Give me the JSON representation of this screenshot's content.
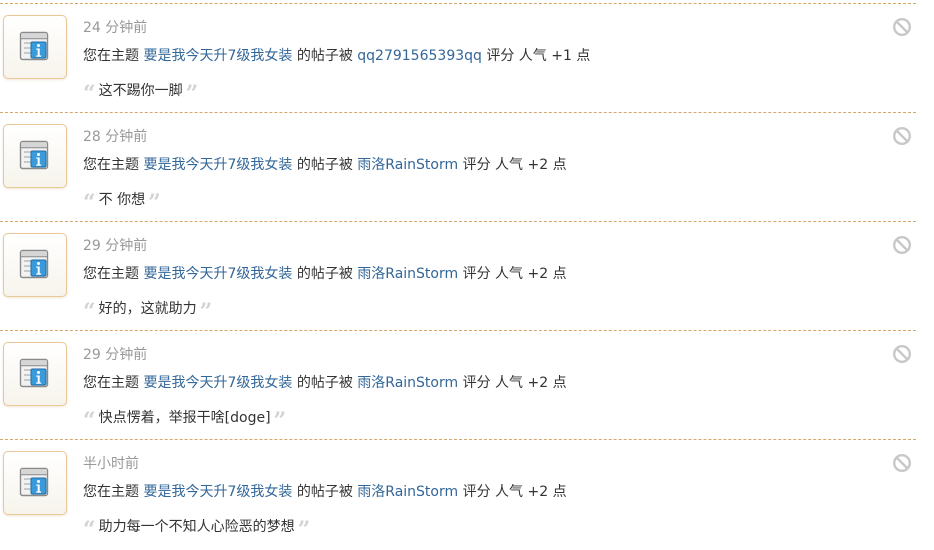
{
  "icons": {
    "avatar": "system-notice-info-icon",
    "ignore": "ignore-notice-icon"
  },
  "colors": {
    "link": "#336699",
    "divider": "#d8a66a",
    "muted": "#999999"
  },
  "notices": [
    {
      "time": "24 分钟前",
      "prefix": "您在主题",
      "thread_title": "要是我今天升7级我女装",
      "middle": "的帖子被",
      "rater": "qq2791565393qq",
      "suffix": "评分 人气 +1 点",
      "reason": "这不踢你一脚"
    },
    {
      "time": "28 分钟前",
      "prefix": "您在主题",
      "thread_title": "要是我今天升7级我女装",
      "middle": "的帖子被",
      "rater": "雨洛RainStorm",
      "suffix": "评分 人气 +2 点",
      "reason": "不 你想"
    },
    {
      "time": "29 分钟前",
      "prefix": "您在主题",
      "thread_title": "要是我今天升7级我女装",
      "middle": "的帖子被",
      "rater": "雨洛RainStorm",
      "suffix": "评分 人气 +2 点",
      "reason": "好的，这就助力"
    },
    {
      "time": "29 分钟前",
      "prefix": "您在主题",
      "thread_title": "要是我今天升7级我女装",
      "middle": "的帖子被",
      "rater": "雨洛RainStorm",
      "suffix": "评分 人气 +2 点",
      "reason": "快点愣着，举报干啥[doge]"
    },
    {
      "time": "半小时前",
      "prefix": "您在主题",
      "thread_title": "要是我今天升7级我女装",
      "middle": "的帖子被",
      "rater": "雨洛RainStorm",
      "suffix": "评分 人气 +2 点",
      "reason": "助力每一个不知人心险恶的梦想"
    }
  ]
}
